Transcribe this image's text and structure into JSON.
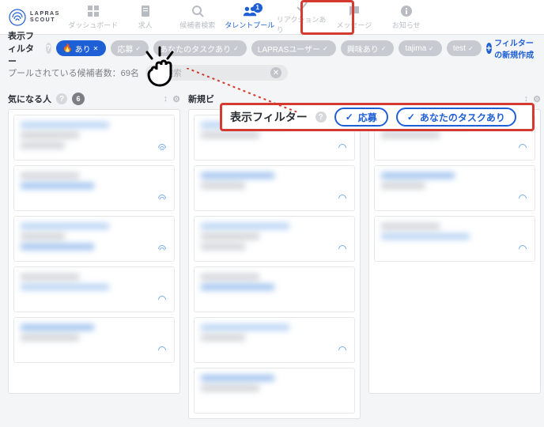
{
  "brand": {
    "line1": "LAPRAS",
    "line2": "SCOUT"
  },
  "nav": [
    {
      "label": "ダッシュボード",
      "icon": "grid"
    },
    {
      "label": "求人",
      "icon": "doc"
    },
    {
      "label": "候補者検索",
      "icon": "search"
    },
    {
      "label": "タレントプール",
      "icon": "people",
      "active": true,
      "badge": "1"
    },
    {
      "label": "リアクションあり",
      "icon": "check"
    },
    {
      "label": "メッセージ",
      "icon": "bubble"
    },
    {
      "label": "お知らせ",
      "icon": "info"
    }
  ],
  "filter": {
    "label": "表示フィルター",
    "chips": [
      {
        "label": "あり",
        "selected": true,
        "flame": true
      },
      {
        "label": "応募",
        "selected": false
      },
      {
        "label": "あなたのタスクあり",
        "selected": false
      },
      {
        "label": "LAPRASユーザー",
        "selected": false
      },
      {
        "label": "興味あり",
        "selected": false
      },
      {
        "label": "tajima",
        "selected": false
      },
      {
        "label": "test",
        "selected": false
      }
    ],
    "add": "フィルターの新規作成"
  },
  "pool_count": {
    "prefix": "プールされている候補者数：",
    "value": "69名"
  },
  "search": {
    "placeholder": "検索"
  },
  "columns": [
    {
      "title": "気になる人",
      "count": "6",
      "cards": 5
    },
    {
      "title": "新規ビ",
      "cards": 6
    },
    {
      "title": "",
      "cards": 3
    }
  ],
  "callout": {
    "title": "表示フィルター",
    "pills": [
      "応募",
      "あなたのタスクあり"
    ]
  }
}
